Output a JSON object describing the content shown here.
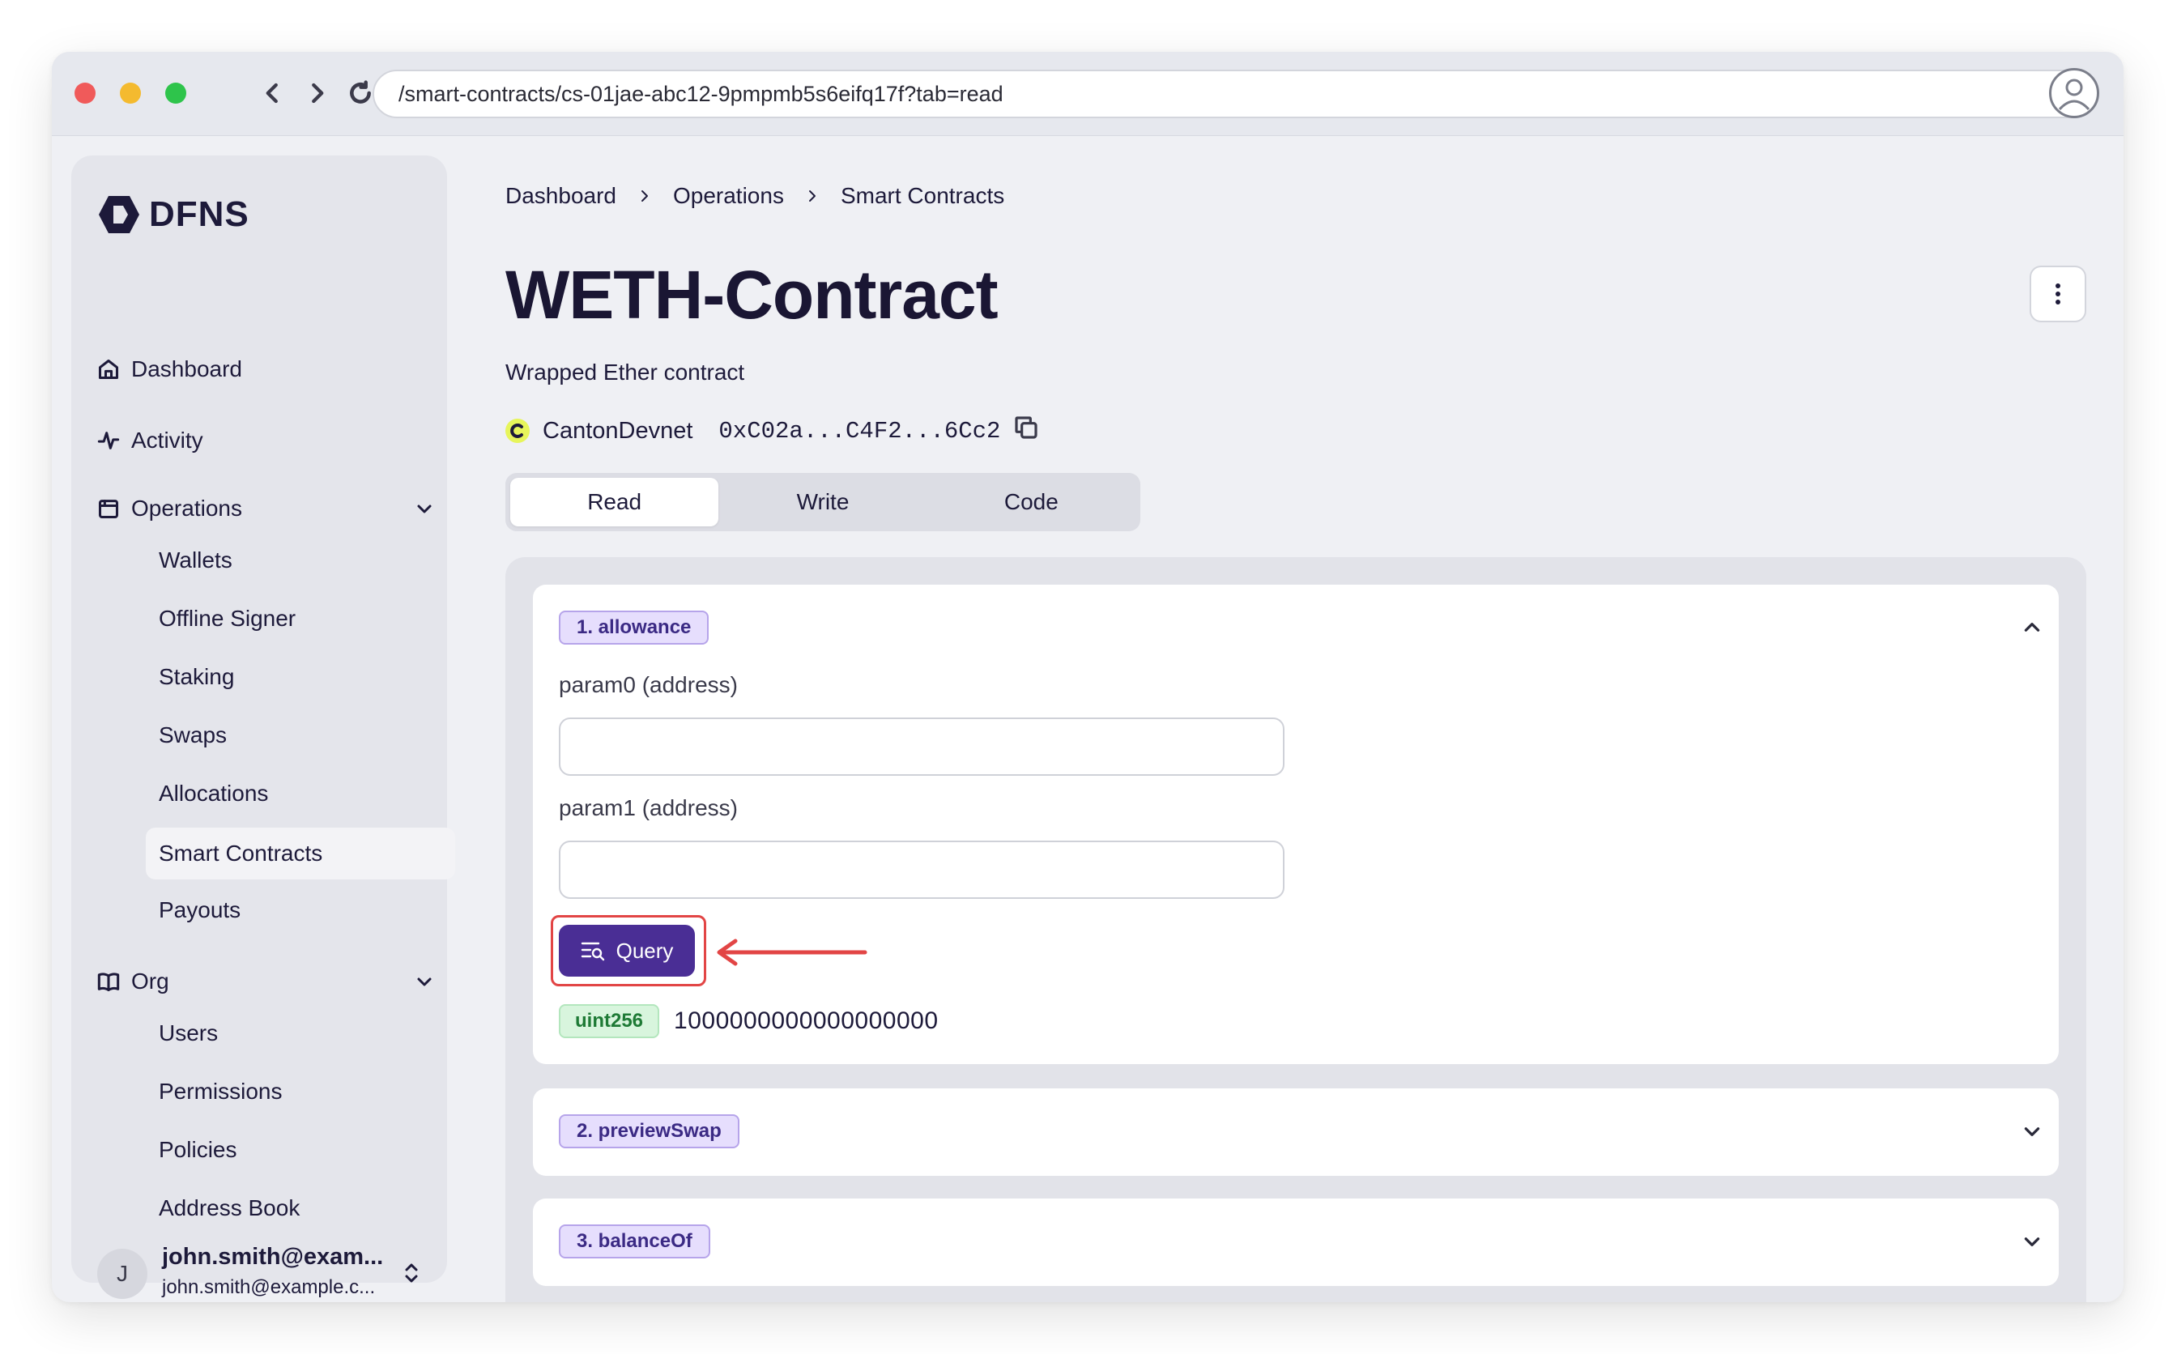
{
  "browser": {
    "url": "/smart-contracts/cs-01jae-abc12-9pmpmb5s6eifq17f?tab=read"
  },
  "sidebar": {
    "logo_text": "DFNS",
    "items": [
      {
        "label": "Dashboard",
        "icon": "home-icon"
      },
      {
        "label": "Activity",
        "icon": "activity-icon"
      },
      {
        "label": "Operations",
        "icon": "operations-icon"
      }
    ],
    "operations_children": [
      "Wallets",
      "Offline Signer",
      "Staking",
      "Swaps",
      "Allocations",
      "Smart Contracts",
      "Payouts"
    ],
    "org_label": "Org",
    "org_children": [
      "Users",
      "Permissions",
      "Policies",
      "Address Book"
    ],
    "active_item": "Smart Contracts",
    "user": {
      "initial": "J",
      "name": "john.smith@exam...",
      "email": "john.smith@example.c..."
    }
  },
  "breadcrumb": [
    "Dashboard",
    "Operations",
    "Smart Contracts"
  ],
  "contract": {
    "title": "WETH-Contract",
    "description": "Wrapped Ether contract",
    "network": "CantonDevnet",
    "address": "0xC02a...C4F2...6Cc2"
  },
  "tabs": [
    "Read",
    "Write",
    "Code"
  ],
  "active_tab": "Read",
  "functions": [
    {
      "badge": "1. allowance",
      "expanded": true,
      "params": [
        {
          "label": "param0 (address)",
          "value": ""
        },
        {
          "label": "param1 (address)",
          "value": ""
        }
      ],
      "query_label": "Query",
      "result_type": "uint256",
      "result_value": "1000000000000000000"
    },
    {
      "badge": "2. previewSwap",
      "expanded": false
    },
    {
      "badge": "3. balanceOf",
      "expanded": false
    }
  ],
  "colors": {
    "accent": "#4a2e95",
    "highlight": "#e24545",
    "badge_purple_bg": "#e6defd",
    "badge_green_bg": "#d8f5dd"
  }
}
